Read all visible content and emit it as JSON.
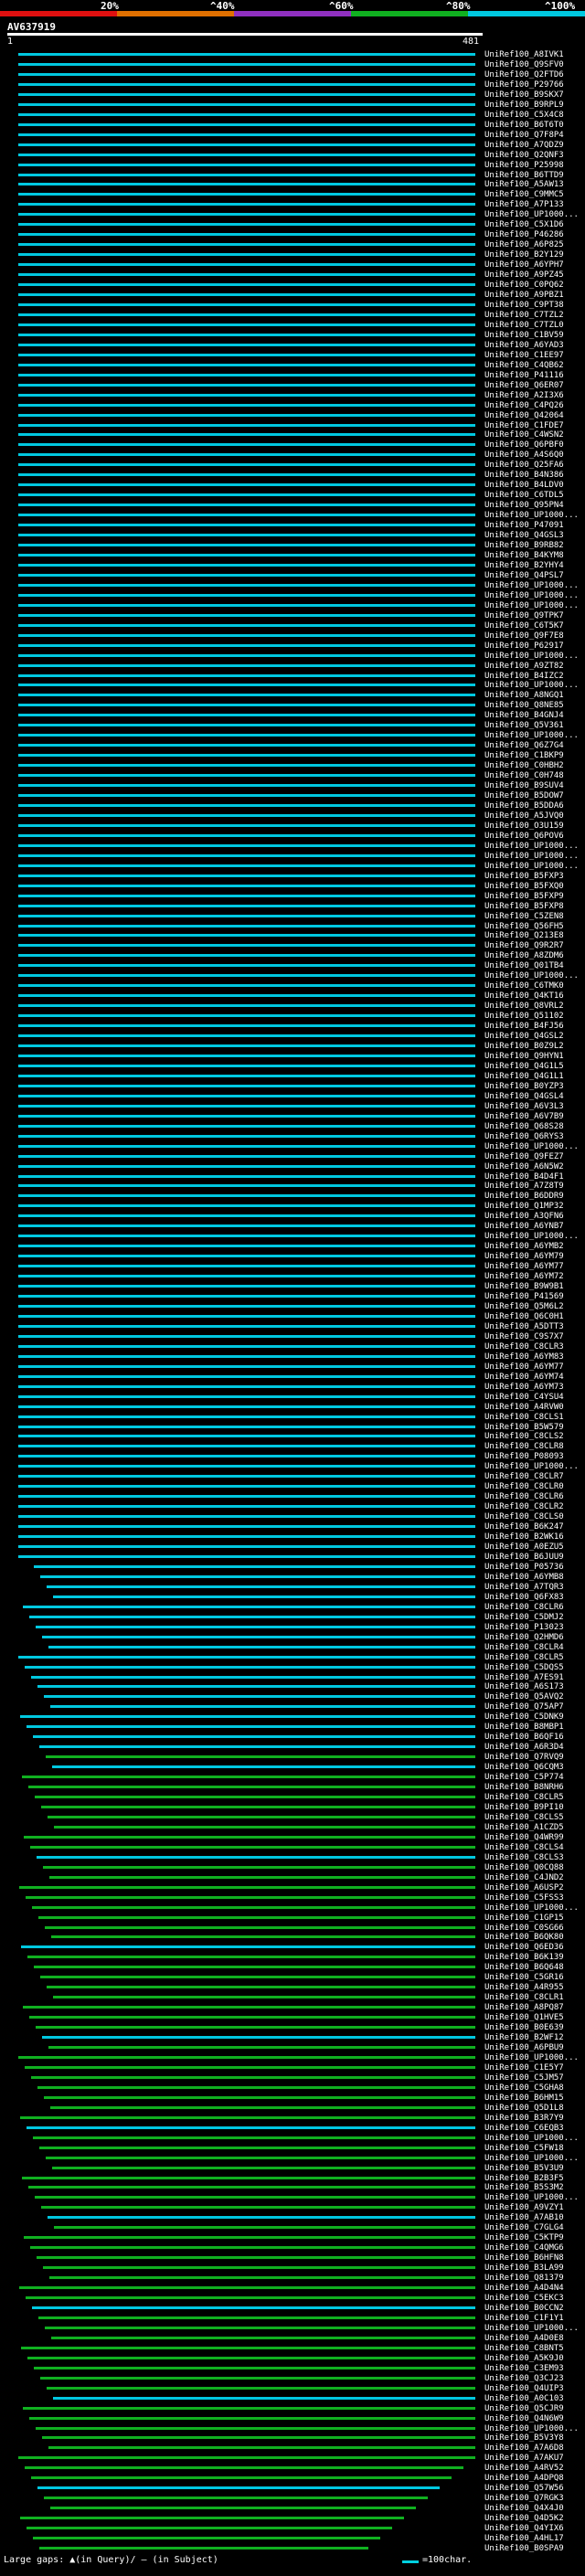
{
  "legend": {
    "labels": [
      "20%",
      "^40%",
      "^60%",
      "^80%",
      "^100%"
    ],
    "colors": [
      "#e01010",
      "#e07000",
      "#9030c0",
      "#10b020",
      "#00c8e0"
    ]
  },
  "query": {
    "title": "AV637919",
    "start": "1",
    "end": "481"
  },
  "hits": [
    "UniRef100_A8IVK1",
    "UniRef100_Q9SFV0",
    "UniRef100_Q2FTD6",
    "UniRef100_P29766",
    "UniRef100_B9SKX7",
    "UniRef100_B9RPL9",
    "UniRef100_C5X4C8",
    "UniRef100_B6T6T0",
    "UniRef100_Q7F8P4",
    "UniRef100_A7QDZ9",
    "UniRef100_Q2QNF3",
    "UniRef100_P25998",
    "UniRef100_B6TTD9",
    "UniRef100_A5AW13",
    "UniRef100_C9MMC5",
    "UniRef100_A7P133",
    "UniRef100_UP1000...",
    "UniRef100_C5X1D6",
    "UniRef100_P46286",
    "UniRef100_A6P825",
    "UniRef100_B2Y129",
    "UniRef100_A6YPH7",
    "UniRef100_A9PZ45",
    "UniRef100_C0PQ62",
    "UniRef100_A9PBZ1",
    "UniRef100_C9PT38",
    "UniRef100_C7TZL2",
    "UniRef100_C7TZL0",
    "UniRef100_C1BV59",
    "UniRef100_A6YAD3",
    "UniRef100_C1EE97",
    "UniRef100_C4QB62",
    "UniRef100_P41116",
    "UniRef100_Q6ER07",
    "UniRef100_A2I3X6",
    "UniRef100_C4PQ26",
    "UniRef100_Q42064",
    "UniRef100_C1FDE7",
    "UniRef100_C4WSN2",
    "UniRef100_Q6PBF0",
    "UniRef100_A4S6Q0",
    "UniRef100_Q25FA6",
    "UniRef100_B4N386",
    "UniRef100_B4LDV0",
    "UniRef100_C6TDL5",
    "UniRef100_Q95PN4",
    "UniRef100_UP1000...",
    "UniRef100_P47091",
    "UniRef100_Q4GSL3",
    "UniRef100_B9RB82",
    "UniRef100_B4KYM8",
    "UniRef100_B2YHY4",
    "UniRef100_Q4PSL7",
    "UniRef100_UP1000...",
    "UniRef100_UP1000...",
    "UniRef100_UP1000...",
    "UniRef100_Q9TPK7",
    "UniRef100_C6T5K7",
    "UniRef100_Q9F7E8",
    "UniRef100_P62917",
    "UniRef100_UP1000...",
    "UniRef100_A9ZT82",
    "UniRef100_B4IZC2",
    "UniRef100_UP1000...",
    "UniRef100_A8NGQ1",
    "UniRef100_Q8NE85",
    "UniRef100_B4GNJ4",
    "UniRef100_Q5V361",
    "UniRef100_UP1000...",
    "UniRef100_Q6Z7G4",
    "UniRef100_C1BKP9",
    "UniRef100_C0HBH2",
    "UniRef100_C0H748",
    "UniRef100_B9SUV4",
    "UniRef100_B5DOW7",
    "UniRef100_B5DDA6",
    "UniRef100_A5JVQ0",
    "UniRef100_O3U159",
    "UniRef100_Q6POV6",
    "UniRef100_UP1000...",
    "UniRef100_UP1000...",
    "UniRef100_UP1000...",
    "UniRef100_B5FXP3",
    "UniRef100_B5FXQ0",
    "UniRef100_B5FXP9",
    "UniRef100_B5FXP8",
    "UniRef100_C5ZEN8",
    "UniRef100_Q56FH5",
    "UniRef100_Q213E8",
    "UniRef100_Q9R2R7",
    "UniRef100_A8ZDM6",
    "UniRef100_Q01TB4",
    "UniRef100_UP1000...",
    "UniRef100_C6TMK0",
    "UniRef100_Q4KT16",
    "UniRef100_Q8VRL2",
    "UniRef100_Q51102",
    "UniRef100_B4FJ56",
    "UniRef100_Q4GSL2",
    "UniRef100_B0Z9L2",
    "UniRef100_Q9HYN1",
    "UniRef100_Q4G1L5",
    "UniRef100_Q4G1L1",
    "UniRef100_B0YZP3",
    "UniRef100_Q4GSL4",
    "UniRef100_A6V3L3",
    "UniRef100_A6V7B9",
    "UniRef100_Q68S28",
    "UniRef100_Q6RYS3",
    "UniRef100_UP1000...",
    "UniRef100_Q9FEZ7",
    "UniRef100_A6N5W2",
    "UniRef100_B4D4F1",
    "UniRef100_A7Z8T9",
    "UniRef100_B6DDR9",
    "UniRef100_Q1MP32",
    "UniRef100_A3QFN6",
    "UniRef100_A6YNB7",
    "UniRef100_UP1000...",
    "UniRef100_A6YMB2",
    "UniRef100_A6YM79",
    "UniRef100_A6YM77",
    "UniRef100_A6YM72",
    "UniRef100_B9W9B1",
    "UniRef100_P41569",
    "UniRef100_Q5M6L2",
    "UniRef100_Q6C0H1",
    "UniRef100_A5DTT3",
    "UniRef100_C9S7X7",
    "UniRef100_C8CLR3",
    "UniRef100_A6YM83",
    "UniRef100_A6YM77",
    "UniRef100_A6YM74",
    "UniRef100_A6YM73",
    "UniRef100_C4YSU4",
    "UniRef100_A4RVW0",
    "UniRef100_C8CLS1",
    "UniRef100_B5W579",
    "UniRef100_C8CLS2",
    "UniRef100_C8CLR8",
    "UniRef100_P08093",
    "UniRef100_UP1000...",
    "UniRef100_C8CLR7",
    "UniRef100_C8CLR0",
    "UniRef100_C8CLR6",
    "UniRef100_C8CLR2",
    "UniRef100_C8CLS0",
    "UniRef100_B6K247",
    "UniRef100_B2WK16",
    "UniRef100_A0EZU5",
    "UniRef100_B6JUU9",
    "UniRef100_P05736",
    "UniRef100_A6YMB8",
    "UniRef100_A7TQR3",
    "UniRef100_Q6FX83",
    "UniRef100_C8CLR6",
    "UniRef100_C5DMJ2",
    "UniRef100_P13023",
    "UniRef100_Q2HMD6",
    "UniRef100_C8CLR4",
    "UniRef100_C8CLR5",
    "UniRef100_C5DQS5",
    "UniRef100_A7ES91",
    "UniRef100_A6S173",
    "UniRef100_Q5AVQ2",
    "UniRef100_Q75AP7",
    "UniRef100_C5DNK9",
    "UniRef100_B8MBP1",
    "UniRef100_B6QF16",
    "UniRef100_A6R3D4",
    "UniRef100_Q7RVQ9",
    "UniRef100_Q6CQM3",
    "UniRef100_C5P774",
    "UniRef100_B8NRH6",
    "UniRef100_C8CLR5",
    "UniRef100_B9PI10",
    "UniRef100_C8CLS5",
    "UniRef100_A1CZD5",
    "UniRef100_Q4WR99",
    "UniRef100_C8CLS4",
    "UniRef100_C8CLS3",
    "UniRef100_Q0CQ88",
    "UniRef100_C4JND2",
    "UniRef100_A6USP2",
    "UniRef100_C5FSS3",
    "UniRef100_UP1000...",
    "UniRef100_C1GP15",
    "UniRef100_C0SG66",
    "UniRef100_B6QK80",
    "UniRef100_Q6ED36",
    "UniRef100_B6K139",
    "UniRef100_B6Q648",
    "UniRef100_C5GR16",
    "UniRef100_A4R955",
    "UniRef100_C8CLR1",
    "UniRef100_A8PQ87",
    "UniRef100_Q1HVE5",
    "UniRef100_B0E639",
    "UniRef100_B2WF12",
    "UniRef100_A6PBU9",
    "UniRef100_UP1000...",
    "UniRef100_C1E5Y7",
    "UniRef100_C5JM57",
    "UniRef100_C5GHA8",
    "UniRef100_B6HM15",
    "UniRef100_Q5D1L8",
    "UniRef100_B3R7Y9",
    "UniRef100_C6EQB3",
    "UniRef100_UP1000...",
    "UniRef100_C5FW18",
    "UniRef100_UP1000...",
    "UniRef100_B5V3U9",
    "UniRef100_B2B3F5",
    "UniRef100_B5S3M2",
    "UniRef100_UP1000...",
    "UniRef100_A9VZY1",
    "UniRef100_A7AB10",
    "UniRef100_C7GLG4",
    "UniRef100_C5KTP9",
    "UniRef100_C4QMG6",
    "UniRef100_B6HFN8",
    "UniRef100_B3LA99",
    "UniRef100_Q81379",
    "UniRef100_A4D4N4",
    "UniRef100_C5EKC3",
    "UniRef100_B0CCN2",
    "UniRef100_C1F1Y1",
    "UniRef100_UP1000...",
    "UniRef100_A4D0E8",
    "UniRef100_C8BNT5",
    "UniRef100_A5K9J0",
    "UniRef100_C3EM93",
    "UniRef100_Q3CJ23",
    "UniRef100_Q4UIP3",
    "UniRef100_A0C103",
    "UniRef100_Q5CJR9",
    "UniRef100_Q4N6W9",
    "UniRef100_UP1000...",
    "UniRef100_B5V3Y8",
    "UniRef100_A7A6D8",
    "UniRef100_A7AKU7",
    "UniRef100_A4RV52",
    "UniRef100_A4DPQ8",
    "UniRef100_Q57W56",
    "UniRef100_Q7RGK3",
    "UniRef100_Q4X4J0",
    "UniRef100_Q4D5K2",
    "UniRef100_Q4YIX6",
    "UniRef100_A4HL17",
    "UniRef100_B0SPA9"
  ],
  "footer": {
    "gaps_text": "Large gaps: ▲(in Query)/ — (in Subject)",
    "scale_text": "=100char."
  }
}
